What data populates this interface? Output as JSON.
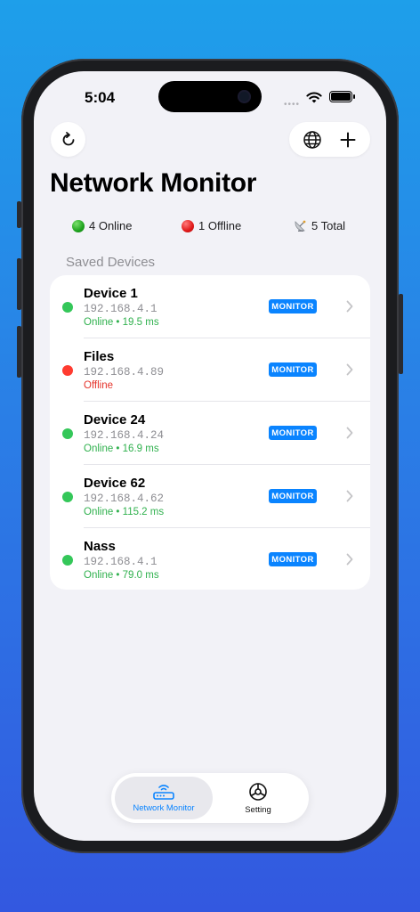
{
  "status": {
    "time": "5:04",
    "signal": "••••"
  },
  "header": {
    "title": "Network Monitor"
  },
  "stats": {
    "online": "4 Online",
    "offline": "1 Offline",
    "total": "5 Total"
  },
  "section_title": "Saved Devices",
  "devices": [
    {
      "name": "Device 1",
      "ip": "192.168.4.1",
      "status": "Online • 19.5 ms",
      "online": true,
      "badge": "MONITOR"
    },
    {
      "name": "Files",
      "ip": "192.168.4.89",
      "status": "Offline",
      "online": false,
      "badge": "MONITOR"
    },
    {
      "name": "Device 24",
      "ip": "192.168.4.24",
      "status": "Online • 16.9 ms",
      "online": true,
      "badge": "MONITOR"
    },
    {
      "name": "Device 62",
      "ip": "192.168.4.62",
      "status": "Online • 115.2 ms",
      "online": true,
      "badge": "MONITOR"
    },
    {
      "name": "Nass",
      "ip": "192.168.4.1",
      "status": "Online • 79.0 ms",
      "online": true,
      "badge": "MONITOR"
    }
  ],
  "tabs": [
    {
      "label": "Network Monitor",
      "icon": "router-icon",
      "active": true
    },
    {
      "label": "Setting",
      "icon": "gear-icon",
      "active": false
    }
  ],
  "colors": {
    "accent": "#0a84ff",
    "online": "#34c759",
    "offline": "#ff3b30",
    "online_text": "#30b14e",
    "offline_text": "#e5332a"
  }
}
